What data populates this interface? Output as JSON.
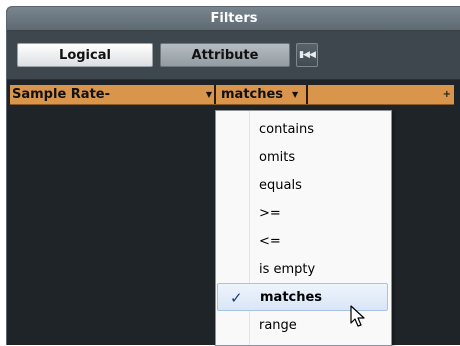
{
  "window": {
    "title": "Filters"
  },
  "toolbar": {
    "logical_label": "Logical",
    "attribute_label": "Attribute",
    "rewind_icon": "skip-to-start-icon"
  },
  "filter_row": {
    "condition_value": "Sample Rate-",
    "operator_value": "matches",
    "colors": {
      "bar": "#d9954b"
    }
  },
  "dropdown": {
    "items": [
      "contains",
      "omits",
      "equals",
      ">=",
      "<=",
      "is empty",
      "matches",
      "range"
    ],
    "selected": "matches"
  }
}
